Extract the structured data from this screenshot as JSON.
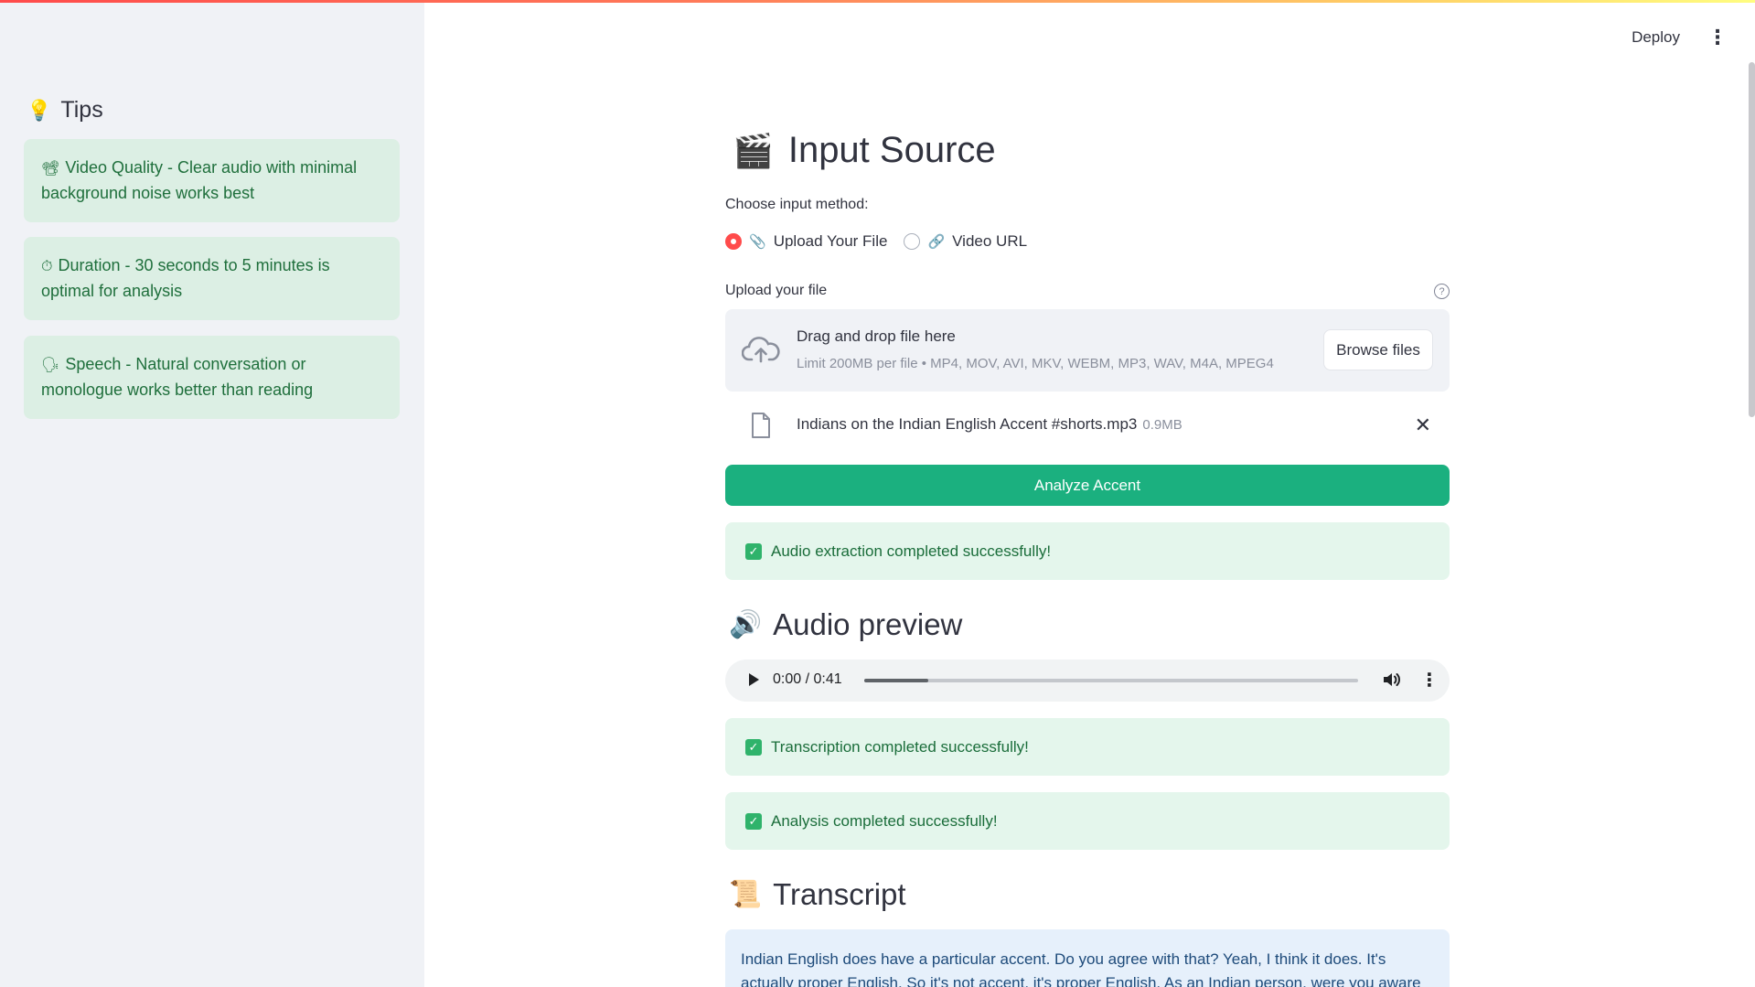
{
  "sidebar": {
    "tips_title": "Tips",
    "tips_icon": "lightbulb-icon",
    "tips": [
      {
        "icon": "film-projector-icon",
        "glyph": "📽",
        "text": "Video Quality - Clear audio with minimal background noise works best"
      },
      {
        "icon": "stopwatch-icon",
        "glyph": "⏱",
        "text": "Duration - 30 seconds to 5 minutes is optimal for analysis"
      },
      {
        "icon": "speaking-head-icon",
        "glyph": "🗣",
        "text": "Speech - Natural conversation or monologue works better than reading"
      }
    ]
  },
  "header": {
    "deploy_label": "Deploy",
    "menu_icon": "kebab-menu-icon"
  },
  "main": {
    "title": "Input Source",
    "title_icon": "clapper-board-icon",
    "input_method_label": "Choose input method:",
    "options": [
      {
        "label": "Upload Your File",
        "icon": "paperclip-icon",
        "selected": true
      },
      {
        "label": "Video URL",
        "icon": "link-icon",
        "selected": false
      }
    ],
    "upload_label": "Upload your file",
    "dropzone_title": "Drag and drop file here",
    "dropzone_limit": "Limit 200MB per file • MP4, MOV, AVI, MKV, WEBM, MP3, WAV, M4A, MPEG4",
    "browse_label": "Browse files",
    "uploaded_file": {
      "name": "Indians on the Indian English Accent #shorts.mp3",
      "size": "0.9MB"
    },
    "analyze_label": "Analyze Accent",
    "status_audio": "Audio extraction completed successfully!",
    "audio_preview_title": "Audio preview",
    "audio_preview_icon": "speaker-icon",
    "audio_player": {
      "time": "0:00 / 0:41",
      "progress": 0.13
    },
    "status_transcription": "Transcription completed successfully!",
    "status_analysis": "Analysis completed successfully!",
    "transcript_title": "Transcript",
    "transcript_icon": "scroll-icon",
    "transcript_text": "Indian English does have a particular accent. Do you agree with that? Yeah, I think it does. It's actually proper English. So it's not accent, it's proper English. As an Indian person, were you aware"
  },
  "colors": {
    "primary": "#ff4b4b",
    "analyze_button": "#1bb07f",
    "success_bg": "#e4f6ec",
    "success_text": "#1a6d3a",
    "info_bg": "#e6f0fb"
  }
}
